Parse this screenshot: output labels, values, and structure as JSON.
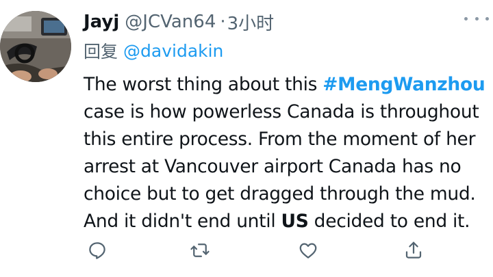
{
  "tweet": {
    "author": {
      "display_name": "Jayj",
      "handle": "@JCVan64"
    },
    "separator": "·",
    "time": "3小时",
    "reply": {
      "prefix": "回复",
      "mention": "@davidakin"
    },
    "text": {
      "line1_pre": "The worst thing about this ",
      "hashtag": "#MengWanzhou",
      "line2": "case is how powerless Canada is throughout",
      "line3": "this entire process. From the moment of her",
      "line4": "arrest at Vancouver airport Canada has no",
      "line5": "choice but to get dragged through the mud.",
      "line6_pre": "And it didn't end until ",
      "line6_bold": "US",
      "line6_post": " decided to end it."
    },
    "actions": [
      "reply-icon",
      "retweet-icon",
      "like-icon",
      "share-icon"
    ],
    "colors": {
      "accent": "#1d9bf0",
      "secondary_text": "#536471",
      "primary_text": "#0f1419",
      "icon": "#536471"
    }
  }
}
